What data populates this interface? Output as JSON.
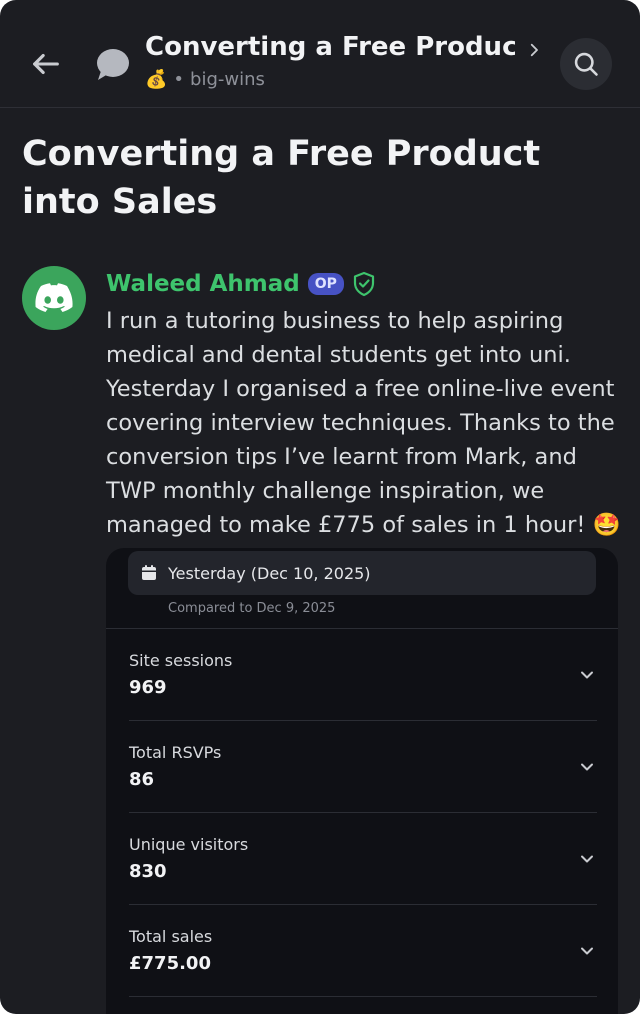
{
  "header": {
    "title": "Converting a Free Product...",
    "emoji": "💰",
    "separator": "•",
    "channel": "big-wins"
  },
  "post": {
    "title": "Converting a Free Product into Sales"
  },
  "message": {
    "author": "Waleed Ahmad",
    "badge": "OP",
    "text": "I run a tutoring business to help aspiring medical and dental students get into uni. Yesterday I organised a free online-live event covering interview techniques. Thanks to the conversion tips I’ve learnt from Mark, and TWP monthly challenge inspiration, we managed to make £775 of sales in 1 hour! 🤩"
  },
  "card": {
    "date_label": "Yesterday (Dec 10, 2025)",
    "compare_label": "Compared to Dec 9, 2025",
    "stats": [
      {
        "label": "Site sessions",
        "value": "969"
      },
      {
        "label": "Total RSVPs",
        "value": "86"
      },
      {
        "label": "Unique visitors",
        "value": "830"
      },
      {
        "label": "Total sales",
        "value": "£775.00"
      }
    ]
  },
  "colors": {
    "background": "#1c1d22",
    "author": "#3ec46d",
    "avatar": "#3ba55c",
    "badge": "#4752c4"
  }
}
